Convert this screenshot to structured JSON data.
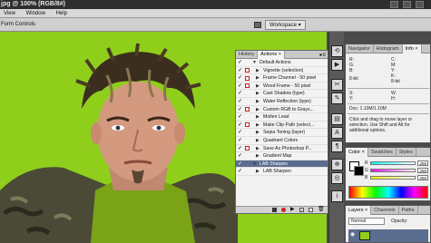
{
  "window": {
    "title": "jpg @ 100% (RGB/8#)"
  },
  "menu": {
    "items": [
      "View",
      "Window",
      "Help"
    ]
  },
  "options_bar": {
    "label": "Form Controls",
    "workspace_label": "Workspace ▾"
  },
  "actions_panel": {
    "tabs": [
      "History",
      "Actions ×"
    ],
    "active_tab": 1,
    "rows": [
      {
        "label": "Default Actions",
        "checked": true,
        "dialog": false,
        "expanded": true,
        "level": 0
      },
      {
        "label": "Vignette (selection)",
        "checked": true,
        "dialog": true,
        "expanded": false,
        "level": 1
      },
      {
        "label": "Frame Channel - 50 pixel",
        "checked": true,
        "dialog": true,
        "expanded": false,
        "level": 1
      },
      {
        "label": "Wood Frame - 50 pixel",
        "checked": true,
        "dialog": true,
        "expanded": false,
        "level": 1
      },
      {
        "label": "Cast Shadow (type)",
        "checked": true,
        "dialog": false,
        "expanded": false,
        "level": 1
      },
      {
        "label": "Water Reflection (type)",
        "checked": true,
        "dialog": false,
        "expanded": false,
        "level": 1
      },
      {
        "label": "Custom RGB to Grays...",
        "checked": true,
        "dialog": true,
        "expanded": false,
        "level": 1
      },
      {
        "label": "Molten Lead",
        "checked": true,
        "dialog": false,
        "expanded": false,
        "level": 1
      },
      {
        "label": "Make Clip Path (select...",
        "checked": true,
        "dialog": true,
        "expanded": false,
        "level": 1
      },
      {
        "label": "Sepia Toning (layer)",
        "checked": true,
        "dialog": false,
        "expanded": false,
        "level": 1
      },
      {
        "label": "Quadrant Colors",
        "checked": true,
        "dialog": false,
        "expanded": false,
        "level": 1
      },
      {
        "label": "Save As Photoshop P...",
        "checked": true,
        "dialog": true,
        "expanded": false,
        "level": 1
      },
      {
        "label": "Gradient Map",
        "checked": true,
        "dialog": false,
        "expanded": false,
        "level": 1
      },
      {
        "label": "LAB Sharpen",
        "checked": true,
        "dialog": false,
        "expanded": true,
        "level": 0,
        "selected": true
      },
      {
        "label": "LAB Sharpen",
        "checked": true,
        "dialog": false,
        "expanded": false,
        "level": 1
      }
    ]
  },
  "info_panel": {
    "tabs": [
      "Navigator",
      "Histogram",
      "Info ×"
    ],
    "active_tab": 2,
    "rgb_labels": [
      "R:",
      "G:",
      "B:"
    ],
    "cmyk_labels": [
      "C:",
      "M:",
      "Y:",
      "K:"
    ],
    "bit_depth_left": "8-bit",
    "bit_depth_right": "8-bit",
    "x_label": "X:",
    "y_label": "Y:",
    "w_label": "W:",
    "h_label": "H:",
    "doc": "Doc: 1.10M/1.10M",
    "hint": "Click and drag to move layer or selection. Use Shift and Alt for additional options."
  },
  "color_panel": {
    "tabs": [
      "Color ×",
      "Swatches",
      "Styles"
    ],
    "active_tab": 0,
    "channels": [
      {
        "label": "R",
        "value": "255",
        "color": "#ff3b3b"
      },
      {
        "label": "G",
        "value": "255",
        "color": "#3bd63b"
      },
      {
        "label": "B",
        "value": "255",
        "color": "#3b6bff"
      }
    ]
  },
  "layers_panel": {
    "tabs": [
      "Layers ×",
      "Channels",
      "Paths"
    ],
    "active_tab": 0,
    "blend_mode": "Normal",
    "opacity_label": "Opacity:"
  },
  "colors": {
    "photo_bg": "#8fcf1c",
    "selection": "#5b6d8f"
  }
}
